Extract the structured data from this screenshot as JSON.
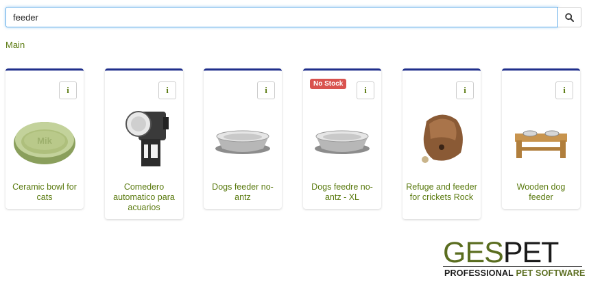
{
  "search": {
    "value": "feeder",
    "icon": "search-icon"
  },
  "breadcrumb": "Main",
  "products": [
    {
      "title": "Ceramic bowl for cats",
      "info": "i",
      "badge": "",
      "image": "ceramic-bowl"
    },
    {
      "title": "Comedero automatico para acuarios",
      "info": "i",
      "badge": "",
      "image": "auto-feeder"
    },
    {
      "title": "Dogs feeder no-antz",
      "info": "i",
      "badge": "",
      "image": "steel-bowl"
    },
    {
      "title": "Dogs feedre no-antz - XL",
      "info": "i",
      "badge": "No Stock",
      "image": "steel-bowl"
    },
    {
      "title": "Refuge and feeder for crickets Rock",
      "info": "i",
      "badge": "",
      "image": "rock-refuge"
    },
    {
      "title": "Wooden dog feeder",
      "info": "i",
      "badge": "",
      "image": "wooden-feeder"
    }
  ],
  "logo": {
    "word_part1": "GES",
    "word_part2": "PET",
    "tagline_part1": "PROFESSIONAL ",
    "tagline_part2": "PET SOFTWARE"
  },
  "colors": {
    "accent_green": "#5a7a0f",
    "card_top_border": "#1f2f8c",
    "badge_red": "#d9534f",
    "focus_blue": "#66afe9"
  }
}
